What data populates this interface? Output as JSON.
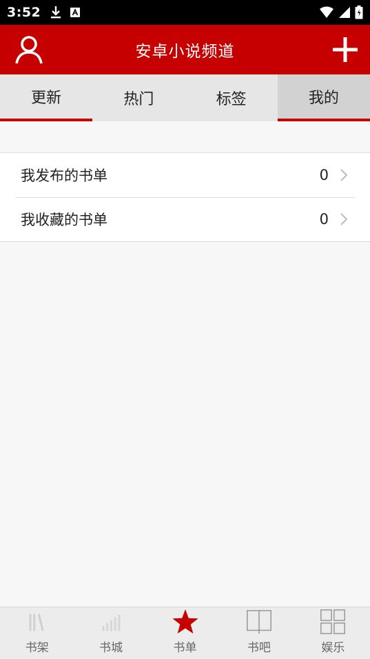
{
  "statusbar": {
    "time": "3:52"
  },
  "header": {
    "title": "安卓小说频道"
  },
  "tabs": [
    {
      "label": "更新"
    },
    {
      "label": "热门"
    },
    {
      "label": "标签"
    },
    {
      "label": "我的"
    }
  ],
  "list": {
    "items": [
      {
        "label": "我发布的书单",
        "count": "0"
      },
      {
        "label": "我收藏的书单",
        "count": "0"
      }
    ]
  },
  "bottom_nav": {
    "items": [
      {
        "label": "书架",
        "icon": "books-icon"
      },
      {
        "label": "书城",
        "icon": "bar-chart-icon"
      },
      {
        "label": "书单",
        "icon": "star-icon"
      },
      {
        "label": "书吧",
        "icon": "open-book-icon"
      },
      {
        "label": "娱乐",
        "icon": "grid-icon"
      }
    ]
  },
  "colors": {
    "brand": "#c60000",
    "inactive": "#cccccc"
  }
}
